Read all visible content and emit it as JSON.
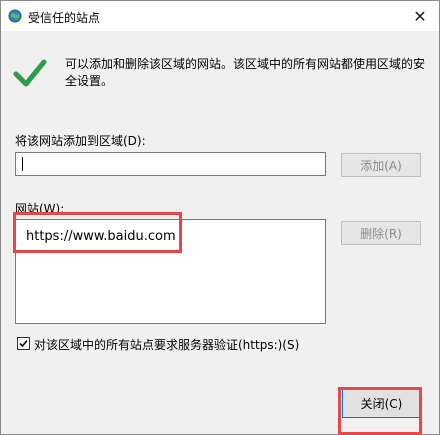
{
  "window": {
    "title": "受信任的站点",
    "close_glyph": "✕"
  },
  "description": "可以添加和删除该区域的网站。该区域中的所有网站都使用区域的安全设置。",
  "add_label": "将该网站添加到区域(D):",
  "add_input_value": "",
  "add_button": "添加(A)",
  "sites_label": "网站(W):",
  "sites": [
    "https://www.baidu.com"
  ],
  "remove_button": "删除(R)",
  "https_checkbox": {
    "label": "对该区域中的所有站点要求服务器验证(https:)(S)",
    "checked": true
  },
  "close_button": "关闭(C)",
  "icons": {
    "title": "globe-icon",
    "success": "checkmark-icon"
  },
  "colors": {
    "highlight": "#e8474a",
    "check": "#2e9c46"
  }
}
